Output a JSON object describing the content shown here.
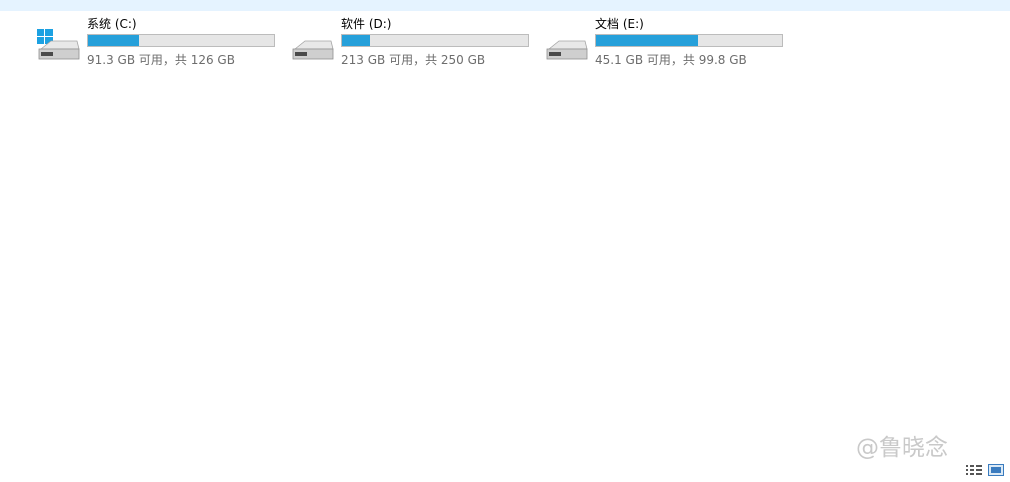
{
  "drives": [
    {
      "name": "系统 (C:)",
      "info": "91.3 GB 可用，共 126 GB",
      "used_fraction": 0.2754,
      "icon": "windows-system-drive-icon"
    },
    {
      "name": "软件 (D:)",
      "info": "213 GB 可用，共 250 GB",
      "used_fraction": 0.148,
      "icon": "hard-drive-icon"
    },
    {
      "name": "文档 (E:)",
      "info": "45.1 GB 可用，共 99.8 GB",
      "used_fraction": 0.5481,
      "icon": "hard-drive-icon"
    }
  ],
  "watermark": "@鲁晓念",
  "status_bar": {
    "view_buttons": [
      "details-view-icon",
      "large-icons-view-icon"
    ]
  },
  "colors": {
    "usage_fill": "#26a0da",
    "usage_track": "#e6e6e6",
    "header_strip": "#e5f3ff"
  }
}
